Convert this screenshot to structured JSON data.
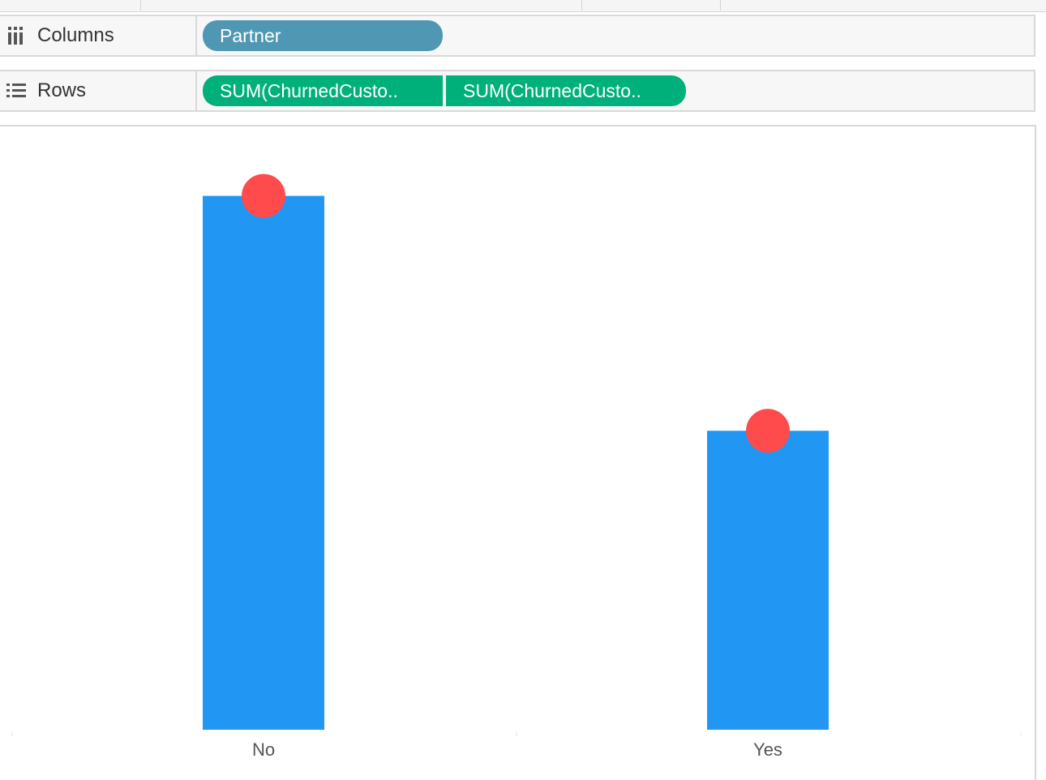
{
  "shelves": {
    "columns": {
      "label": "Columns",
      "pills": [
        {
          "text": "Partner"
        }
      ]
    },
    "rows": {
      "label": "Rows",
      "pills": [
        {
          "text": "SUM(ChurnedCusto.."
        },
        {
          "text": "SUM(ChurnedCusto.."
        }
      ]
    }
  },
  "colors": {
    "bar": "#2196f3",
    "dot": "#ff4b4b",
    "dimension_pill": "#4f97b3",
    "measure_pill": "#00b07a"
  },
  "chart_data": {
    "type": "bar",
    "categories": [
      "No",
      "Yes"
    ],
    "series": [
      {
        "mark": "bar",
        "values": [
          1,
          0.56
        ]
      },
      {
        "mark": "circle",
        "values": [
          1,
          0.56
        ]
      }
    ],
    "title": "",
    "xlabel": "",
    "ylabel": "",
    "ylim": [
      0,
      1.13
    ],
    "grid": false
  }
}
